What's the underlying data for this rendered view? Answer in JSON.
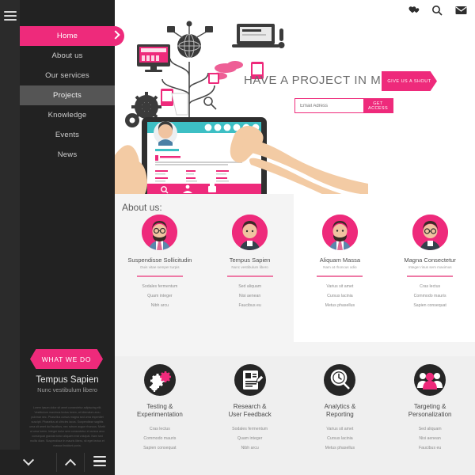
{
  "sidebar": {
    "menu_icon": "hamburger-icon",
    "nav": [
      {
        "label": "Home",
        "state": "active"
      },
      {
        "label": "About us",
        "state": "normal"
      },
      {
        "label": "Our services",
        "state": "normal"
      },
      {
        "label": "Projects",
        "state": "hover"
      },
      {
        "label": "Knowledge",
        "state": "normal"
      },
      {
        "label": "Events",
        "state": "normal"
      },
      {
        "label": "News",
        "state": "normal"
      }
    ],
    "ribbon_label": "WHAT WE DO",
    "promo_title": "Tempus Sapien",
    "promo_subtitle": "Nunc vestibulum libero",
    "promo_body": "Lorem ipsum dolor sit amet consectetur adipiscing elit. Vestibulum maximus lectus lorem, at bibendum arcu pulvinar nec. Phasellus cursus magna sed urna imperdiet suscipit. Phasellus at ultricies lacus. Suspendisse sagittis urna sit amet dui faucibus, nec rutrum augue rhoncus. Morbi ut urna lorem. Integer dolor sem consectetur et cursus arcu consequat gravida tortor aliquam erat volutpat. Nam sed mollis diam. Suspendisse in mauris libero, sit eget lectus et massa tincidunt porta.",
    "bottom_bar": [
      "chevron-down-icon",
      "chevron-up-icon",
      "hamburger-icon"
    ],
    "accent_color": "#ee2a7b",
    "bg_color": "#222222"
  },
  "topbar": {
    "icons": [
      {
        "name": "hearts-icon",
        "glyph": "♥♥"
      },
      {
        "name": "search-icon",
        "glyph": "⚲"
      },
      {
        "name": "mail-icon",
        "glyph": "✉"
      }
    ]
  },
  "hero": {
    "heading": "HAVE A PROJECT IN MIND?",
    "cta_label": "GIVE US A SHOUT",
    "email_placeholder": "Email Adress",
    "email_value": "",
    "submit_label": "GET ACCESS",
    "illustration": "tablet-network-tree-hands"
  },
  "about": {
    "title": "About us:",
    "cards": [
      {
        "name": "Suspendisse Sollicitudin",
        "role": "Duis vitae semper turpis",
        "avatar": "avatar-bearded-man-glasses",
        "list": [
          "Sodales fermentum",
          "Quam integer",
          "Nibh arcu"
        ]
      },
      {
        "name": "Tempus Sapien",
        "role": "Nunc vestibulum libero",
        "avatar": "avatar-woman-short-hair",
        "list": [
          "Sed aliquam",
          "Nisi aenean",
          "Faucibus eu"
        ]
      },
      {
        "name": "Aliquam Massa",
        "role": "Nam at rhoncus odio",
        "avatar": "avatar-man-beard-tie",
        "list": [
          "Varius sit amet",
          "Cursus lacinia",
          "Metus phasellus"
        ]
      },
      {
        "name": "Magna Consectetur",
        "role": "Integer risus sem maximus",
        "avatar": "avatar-woman-glasses",
        "list": [
          "Cras lectus",
          "Commodo mauris",
          "Sapien consequat"
        ]
      }
    ]
  },
  "services": [
    {
      "icon": "gears-icon",
      "title": "Testing &\nExperimentation",
      "list": [
        "Cras lectus",
        "Commodo mauris",
        "Sapien consequat"
      ]
    },
    {
      "icon": "document-pen-icon",
      "title": "Research &\nUser Feedback",
      "list": [
        "Sodales fermentum",
        "Quam integer",
        "Nibh arcu"
      ]
    },
    {
      "icon": "magnifier-clock-icon",
      "title": "Analytics &\nReporting",
      "list": [
        "Varius sit amet",
        "Cursus lacinia",
        "Metus phasellus"
      ]
    },
    {
      "icon": "people-group-icon",
      "title": "Targeting &\nPersonalization",
      "list": [
        "Sed aliquam",
        "Nisi aenean",
        "Faucibus eu"
      ]
    }
  ]
}
